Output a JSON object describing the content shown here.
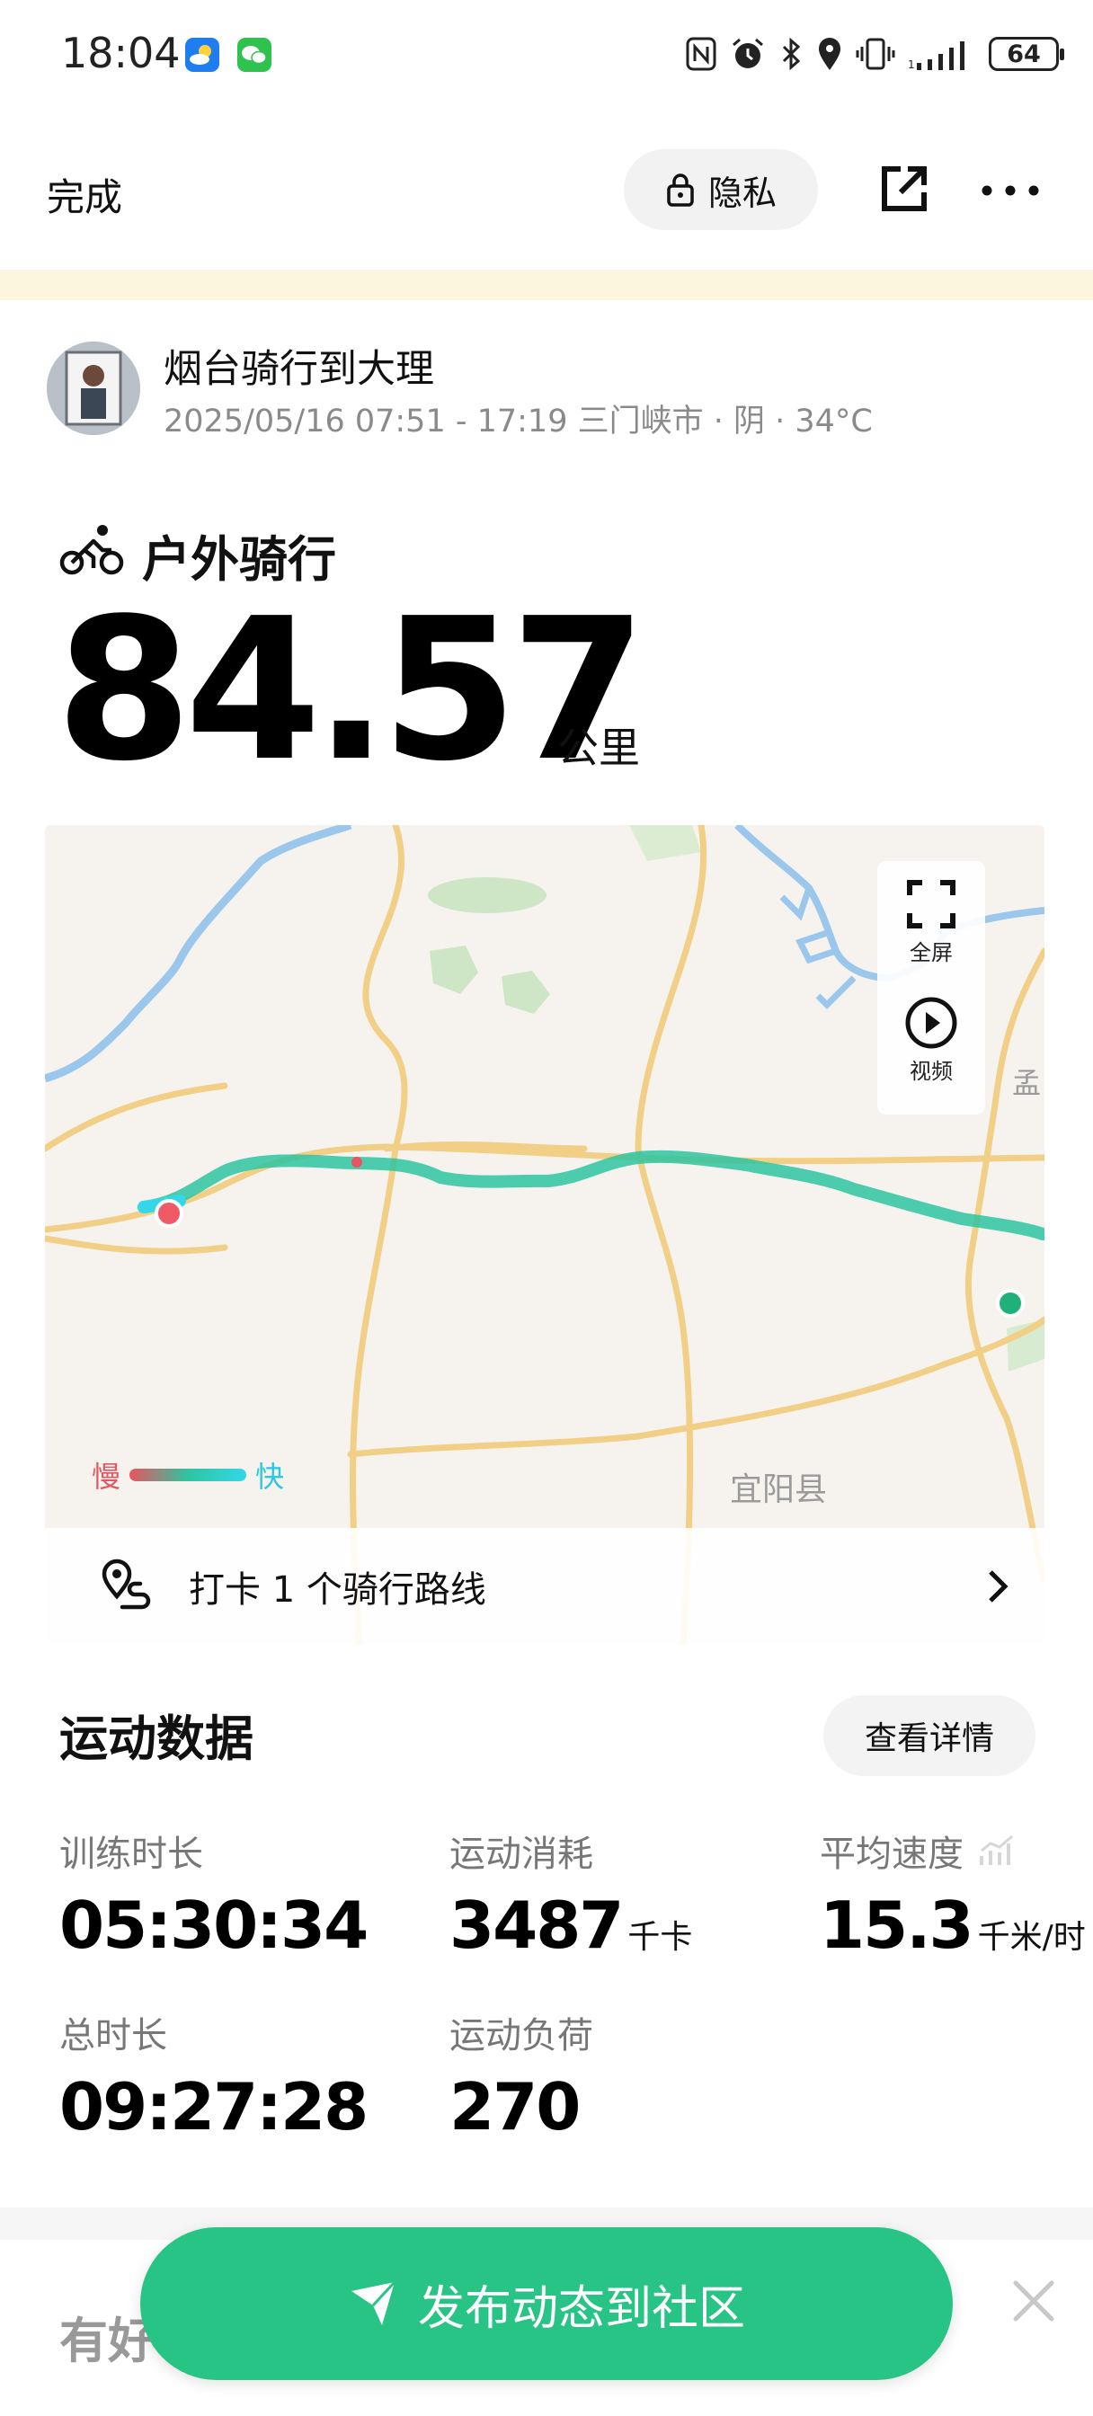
{
  "status_bar": {
    "time": "18:04",
    "battery": "64",
    "icons": [
      "weather-app-icon",
      "wechat-icon",
      "nfc-icon",
      "alarm-icon",
      "bluetooth-icon",
      "location-icon",
      "vibrate-icon",
      "signal-icon",
      "battery-icon"
    ]
  },
  "top_bar": {
    "done": "完成",
    "privacy": "隐私"
  },
  "activity": {
    "title": "烟台骑行到大理",
    "subtitle": "2025/05/16 07:51 - 17:19 三门峡市 · 阴 · 34°C",
    "sport_type": "户外骑行",
    "distance": "84.57",
    "distance_unit": "公里"
  },
  "map": {
    "fullscreen": "全屏",
    "video": "视频",
    "legend_slow": "慢",
    "legend_fast": "快",
    "place_label": "宜阳县",
    "edge_label_1": "孟",
    "route_checkin": "打卡 1 个骑行路线",
    "colors": {
      "route": "#2ec4a0",
      "slow": "#e8555e",
      "fast": "#32d8e8"
    }
  },
  "stats": {
    "section_title": "运动数据",
    "detail_button": "查看详情",
    "items": [
      {
        "label": "训练时长",
        "value": "05:30:34",
        "unit": ""
      },
      {
        "label": "运动消耗",
        "value": "3487",
        "unit": "千卡"
      },
      {
        "label": "平均速度",
        "value": "15.3",
        "unit": "千米/时"
      },
      {
        "label": "总时长",
        "value": "09:27:28",
        "unit": ""
      },
      {
        "label": "运动负荷",
        "value": "270",
        "unit": ""
      }
    ]
  },
  "footer": {
    "peek_title": "有好",
    "publish": "发布动态到社区",
    "accent": "#27c485"
  }
}
